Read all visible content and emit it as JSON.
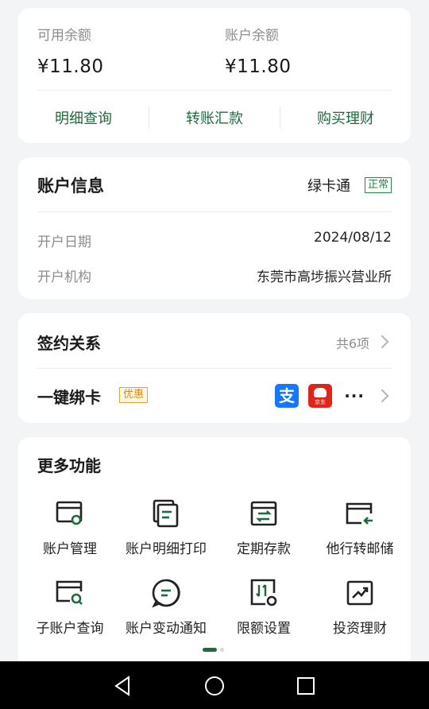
{
  "balance": {
    "available_label": "可用余额",
    "available_amount": "¥11.80",
    "account_label": "账户余额",
    "account_amount": "¥11.80",
    "actions": [
      "明细查询",
      "转账汇款",
      "购买理财"
    ]
  },
  "account_info": {
    "title": "账户信息",
    "card_name": "绿卡通",
    "status": "正常",
    "open_date_label": "开户日期",
    "open_date_value": "2024/08/12",
    "open_branch_label": "开户机构",
    "open_branch_value": "东莞市高埗振兴营业所"
  },
  "signing": {
    "title": "签约关系",
    "count": "共6项",
    "bind_title": "一键绑卡",
    "bind_badge": "优惠",
    "alipay_glyph": "支",
    "jd_text": "京东",
    "more": "···"
  },
  "more_functions": {
    "title": "更多功能",
    "items": [
      {
        "label": "账户管理",
        "icon": "account-manage-icon"
      },
      {
        "label": "账户明细打印",
        "icon": "print-icon"
      },
      {
        "label": "定期存款",
        "icon": "fixed-deposit-icon"
      },
      {
        "label": "他行转邮储",
        "icon": "transfer-in-icon"
      },
      {
        "label": "子账户查询",
        "icon": "sub-account-search-icon"
      },
      {
        "label": "账户变动通知",
        "icon": "notification-icon"
      },
      {
        "label": "限额设置",
        "icon": "limit-settings-icon"
      },
      {
        "label": "投资理财",
        "icon": "investment-icon"
      }
    ]
  },
  "colors": {
    "accent": "#1d6b3c",
    "badge_green": "#1d8a45",
    "badge_orange": "#d18a16",
    "background": "#f3f4f6"
  },
  "navbar": {
    "buttons": [
      "back-icon",
      "home-icon",
      "recents-icon"
    ]
  }
}
